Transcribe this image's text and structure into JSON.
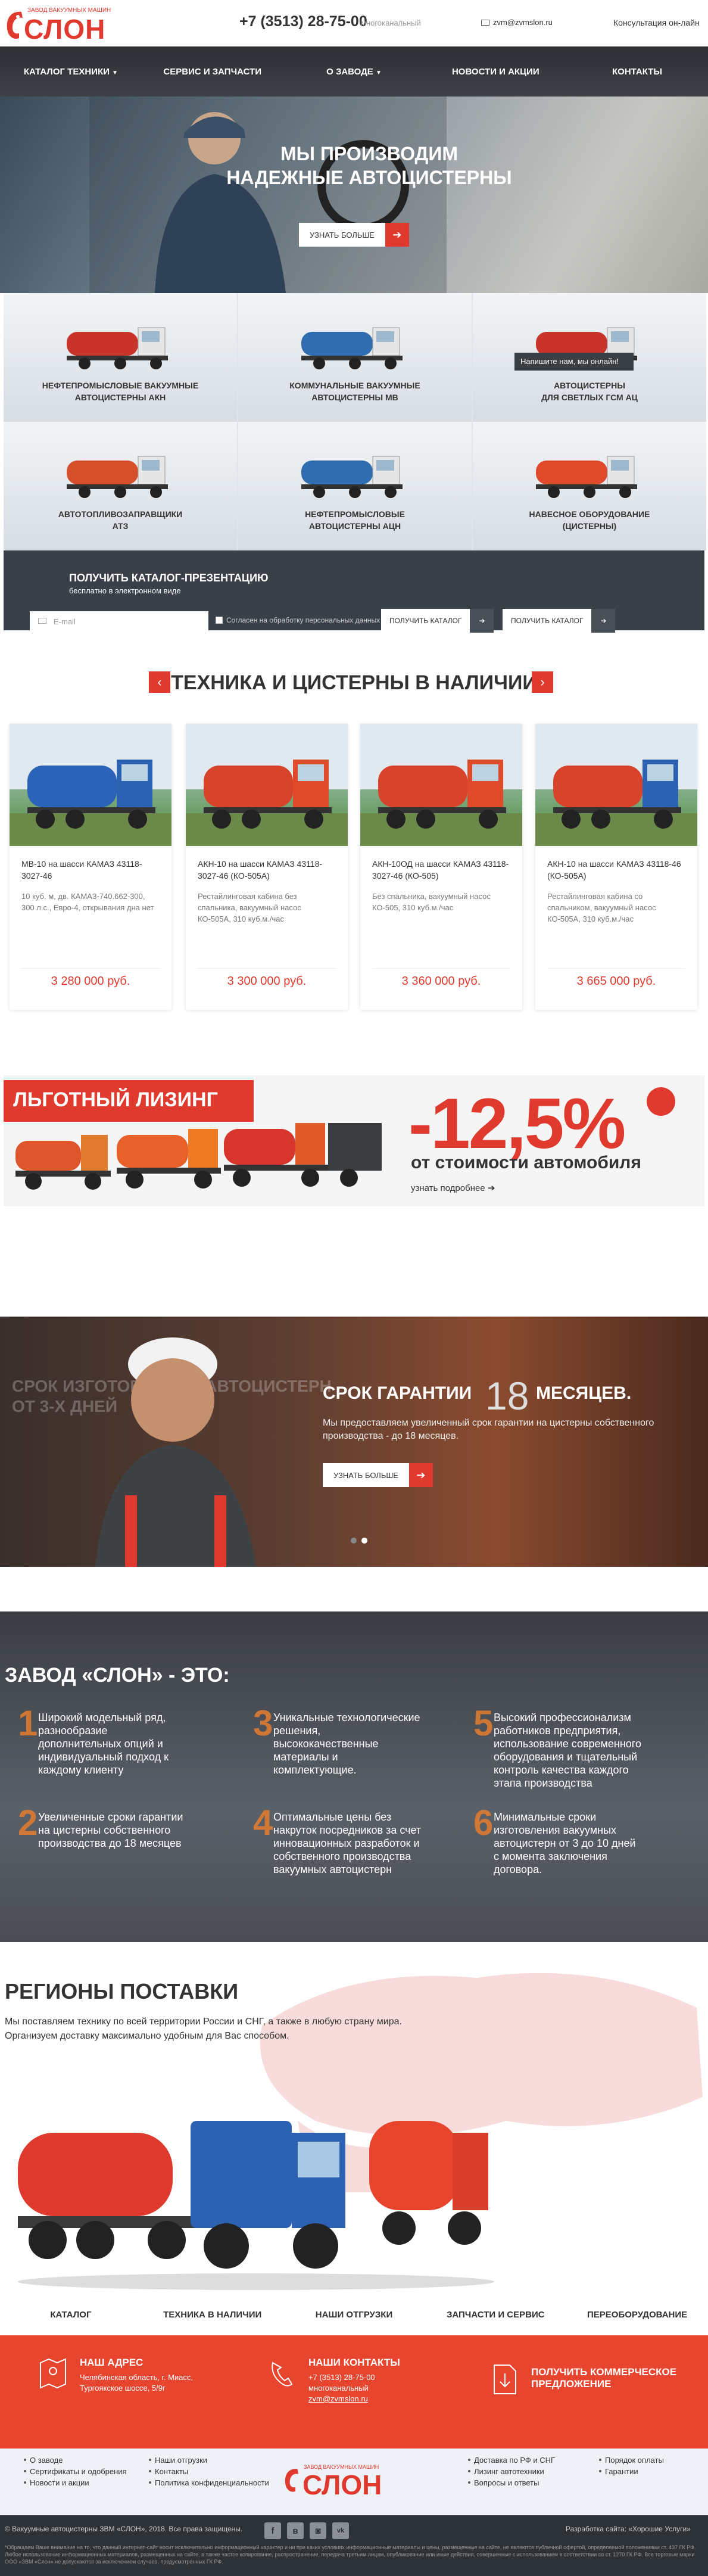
{
  "header": {
    "logo_small": "ЗАВОД ВАКУУМНЫХ МАШИН",
    "logo_big": "СЛОН",
    "phone": "+7 (3513) 28-75-00",
    "phone_note": "многоканальный",
    "email": "zvm@zvmslon.ru",
    "consult": "Консультация он-лайн"
  },
  "nav": [
    "КАТАЛОГ ТЕХНИКИ",
    "СЕРВИС И ЗАПЧАСТИ",
    "О ЗАВОДЕ",
    "НОВОСТИ И АКЦИИ",
    "КОНТАКТЫ"
  ],
  "hero": {
    "line1": "МЫ ПРОИЗВОДИМ",
    "line2": "НАДЕЖНЫЕ АВТОЦИСТЕРНЫ",
    "button": "УЗНАТЬ БОЛЬШЕ",
    "arrow": "➔"
  },
  "categories": [
    {
      "l1": "НЕФТЕПРОМЫСЛОВЫЕ ВАКУУМНЫЕ",
      "l2": "АВТОЦИСТЕРНЫ АКН",
      "color": "#c8332a"
    },
    {
      "l1": "КОММУНАЛЬНЫЕ ВАКУУМНЫЕ",
      "l2": "АВТОЦИСТЕРНЫ МВ",
      "color": "#2f6db0"
    },
    {
      "l1": "АВТОЦИСТЕРНЫ",
      "l2": "ДЛЯ СВЕТЛЫХ ГСМ АЦ",
      "color": "#c8332a"
    },
    {
      "l1": "АВТОТОПЛИВОЗАПРАВЩИКИ",
      "l2": "АТЗ",
      "color": "#d5502a"
    },
    {
      "l1": "НЕФТЕПРОМЫСЛОВЫЕ",
      "l2": "АВТОЦИСТЕРНЫ АЦН",
      "color": "#2f6db0"
    },
    {
      "l1": "НАВЕСНОЕ ОБОРУДОВАНИЕ",
      "l2": "(ЦИСТЕРНЫ)",
      "color": "#e04a2a"
    }
  ],
  "chat": "Напишите нам, мы онлайн!",
  "catalog": {
    "title": "ПОЛУЧИТЬ КАТАЛОГ-ПРЕЗЕНТАЦИЮ",
    "subtitle": "бесплатно в электронном виде",
    "email_placeholder": "E-mail",
    "consent": "Согласен на обработку персональных данных",
    "btn1": "ПОЛУЧИТЬ КАТАЛОГ",
    "btn2": "ПОЛУЧИТЬ КАТАЛОГ",
    "arrow": "➔"
  },
  "stock": {
    "title": "ТЕХНИКА И ЦИСТЕРНЫ В НАЛИЧИИ",
    "prev": "‹",
    "next": "›",
    "items": [
      {
        "name": "МВ-10 на шасси КАМАЗ 43118-3027-46",
        "desc": "10 куб. м, дв. КАМАЗ-740.662-300, 300 л.с., Евро-4, открывания дна нет",
        "price": "3 280 000 руб.",
        "tank": "#2b63b8"
      },
      {
        "name": "АКН-10 на шасси КАМАЗ 43118-3027-46 (КО-505А)",
        "desc": "Рестайлинговая кабина без спальника, вакуумный насос КО-505А, 310 куб.м./час",
        "price": "3 300 000 руб.",
        "tank": "#d8432c"
      },
      {
        "name": "АКН-10ОД на шасси КАМАЗ 43118-3027-46 (КО-505)",
        "desc": "Без спальника, вакуумный насос КО-505, 310 куб.м./час",
        "price": "3 360 000 руб.",
        "tank": "#d8432c"
      },
      {
        "name": "АКН-10 на шасси КАМАЗ 43118-46 (КО-505А)",
        "desc": "Рестайлинговая кабина со спальником, вакуумный насос КО-505А, 310 куб.м./час",
        "price": "3 665 000 руб.",
        "tank": "#d8432c"
      }
    ]
  },
  "leasing": {
    "title": "ЛЬГОТНЫЙ ЛИЗИНГ",
    "percent": "-12,5%",
    "subtitle": "от стоимости автомобиля",
    "more": "узнать подробнее ➔"
  },
  "warranty": {
    "ghost1": "СРОК ИЗГОТОВЛЕНИЯ АВТОЦИСТЕРН",
    "ghost2": "ОТ 3-Х ДНЕЙ",
    "title": "СРОК ГАРАНТИИ",
    "months": "18",
    "title2": "МЕСЯЦЕВ.",
    "desc": "Мы предоставляем увеличенный срок гарантии на цистерны собственного производства - до 18 месяцев.",
    "button": "УЗНАТЬ БОЛЬШЕ",
    "arrow": "➔"
  },
  "about": {
    "title": "ЗАВОД «СЛОН» - ЭТО:",
    "features": [
      {
        "n": "1",
        "t": "Широкий модельный ряд, разнообразие дополнительных опций и индивидуальный подход к каждому клиенту"
      },
      {
        "n": "3",
        "t": "Уникальные технологические решения, высококачественные материалы и комплектующие."
      },
      {
        "n": "5",
        "t": "Высокий профессионализм работников предприятия, использование современного оборудования и тщательный контроль качества каждого этапа производства"
      },
      {
        "n": "2",
        "t": "Увеличенные сроки гарантии на цистерны собственного производства до 18 месяцев"
      },
      {
        "n": "4",
        "t": "Оптимальные цены без накруток посредников за счет инновационных разработок и собственного производства вакуумных автоцистерн"
      },
      {
        "n": "6",
        "t": "Минимальные сроки изготовления вакуумных автоцистерн от 3 до 10 дней с момента заключения договора."
      }
    ]
  },
  "regions": {
    "title": "РЕГИОНЫ ПОСТАВКИ",
    "line1": "Мы поставляем технику по всей территории России и СНГ, а также в любую страну мира.",
    "line2": "Организуем доставку максимально удобным для Вас способом."
  },
  "footer_nav": [
    "КАТАЛОГ",
    "ТЕХНИКА В НАЛИЧИИ",
    "НАШИ ОТГРУЗКИ",
    "ЗАПЧАСТИ И СЕРВИС",
    "ПЕРЕОБОРУДОВАНИЕ"
  ],
  "footer_contacts": {
    "addr_title": "НАШ АДРЕС",
    "addr1": "Челябинская область, г. Миасс,",
    "addr2": "Тургоякское шоссе, 5/9г",
    "cont_title": "НАШИ КОНТАКТЫ",
    "phone": "+7 (3513) 28-75-00",
    "phone_note": "многоканальный",
    "email": "zvm@zvmslon.ru",
    "offer1": "ПОЛУЧИТЬ КОММЕРЧЕСКОЕ",
    "offer2": "ПРЕДЛОЖЕНИЕ"
  },
  "footer_links": {
    "col1": [
      "О заводе",
      "Сертификаты и одобрения",
      "Новости и акции"
    ],
    "col2": [
      "Наши отгрузки",
      "Контакты",
      "Политика конфиденциальности"
    ],
    "col3": [
      "Доставка по РФ и СНГ",
      "Лизинг автотехники",
      "Вопросы и ответы"
    ],
    "col4": [
      "Порядок оплаты",
      "Гарантии"
    ]
  },
  "footer_bottom": {
    "copyright": "© Вакуумные автоцистерны ЗВМ «СЛОН», 2018. Все права защищены.",
    "developer": "Разработка сайта: «Хорошие Услуги»",
    "social": [
      "f",
      "в",
      "◙",
      "vk"
    ],
    "legal": "*Обращаем Ваше внимание на то, что данный интернет-сайт носит исключительно информационный характер и ни при каких условиях информационные материалы и цены, размещенные на сайте, не являются публичной офертой, определяемой положениями ст. 437 ГК РФ. Любое использование информационных материалов, размещенных на сайте, а также частое копирование, распространение, передача третьим лицам, опубликование или иные действия, совершенные с использованием в соответствии со ст. 1270 ГК РФ. Все торговые марки ООО «ЗВМ «Слон» не допускаются за исключением случаев, предусмотренных ГК РФ."
  },
  "colors": {
    "accent": "#e03a2e",
    "dark": "#2d3237",
    "orange": "#e67d2e"
  }
}
